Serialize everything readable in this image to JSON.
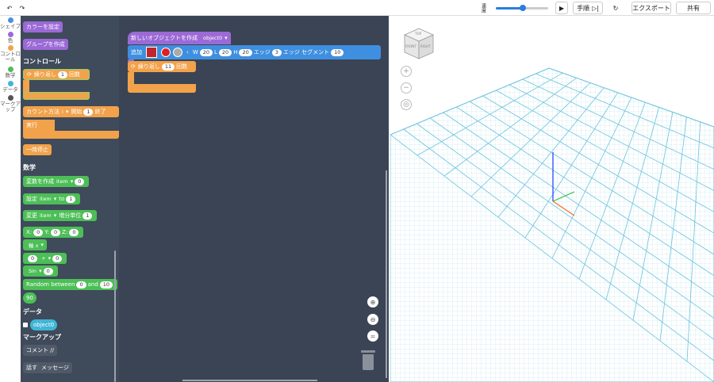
{
  "topbar": {
    "undo_icon": "↶",
    "redo_icon": "↷",
    "speed_label": "速度",
    "step_label": "手順",
    "export_label": "エクスポート",
    "share_label": "共有"
  },
  "categories": [
    {
      "label": "シェイプ",
      "color": "#4a90e2"
    },
    {
      "label": "色",
      "color": "#9b6ad6"
    },
    {
      "label": "コントロール",
      "color": "#f2a24a"
    },
    {
      "label": "数学",
      "color": "#4cbf56"
    },
    {
      "label": "データ",
      "color": "#3fb6d6"
    },
    {
      "label": "マークアップ",
      "color": "#555555"
    }
  ],
  "flyout": {
    "color_set": "カラーを設定",
    "group_create": "グループを作成",
    "control_header": "コントロール",
    "repeat_label": "繰り返し",
    "repeat_count": "1",
    "repeat_suffix": "回数",
    "count_label": "カウント方法",
    "count_var": "i",
    "count_start_label": "開始",
    "count_start": "1",
    "count_end_label": "終了",
    "do_label": "実行",
    "pause_label": "一時停止",
    "math_header": "数学",
    "create_var": "変数を作成",
    "var_item": "item",
    "var_zero": "0",
    "set_label": "設定",
    "to_label": "to",
    "set_value": "1",
    "change_label": "変更",
    "change_by_label": "増分単位",
    "change_value": "1",
    "x_label": "X:",
    "x_value": "0",
    "y_label": "Y:",
    "y_value": "0",
    "z_label": "Z:",
    "z_value": "0",
    "axis_label": "軸 x",
    "op_left": "0",
    "op_symbol": "+",
    "op_right": "0",
    "sin_label": "Sin",
    "sin_value": "0",
    "random_label": "Random between",
    "random_from": "0",
    "random_and": "and",
    "random_to": "10",
    "ninety": "90",
    "data_header": "データ",
    "object_var": "object0",
    "markup_header": "マークアップ",
    "comment_label": "コメント //",
    "say_label": "話す",
    "say_message": "メッセージ"
  },
  "workspace": {
    "new_object_label": "新しいオブジェクトを作成",
    "object_name": "object0",
    "add_label": "追加",
    "w_label": "W",
    "w_value": "20",
    "l_label": "L",
    "l_value": "20",
    "h_label": "H",
    "h_value": "20",
    "edge_label": "エッジ",
    "edge_value": "3",
    "edge_seg_label": "エッジ セグメント",
    "edge_seg_value": "10",
    "repeat_label": "繰り返し",
    "repeat_count": "11",
    "repeat_suffix": "回数",
    "shape_color": "#e02020"
  },
  "viewport": {
    "view_cube_top": "TOP",
    "view_cube_front": "FRONT",
    "view_cube_right": "RIGHT"
  }
}
